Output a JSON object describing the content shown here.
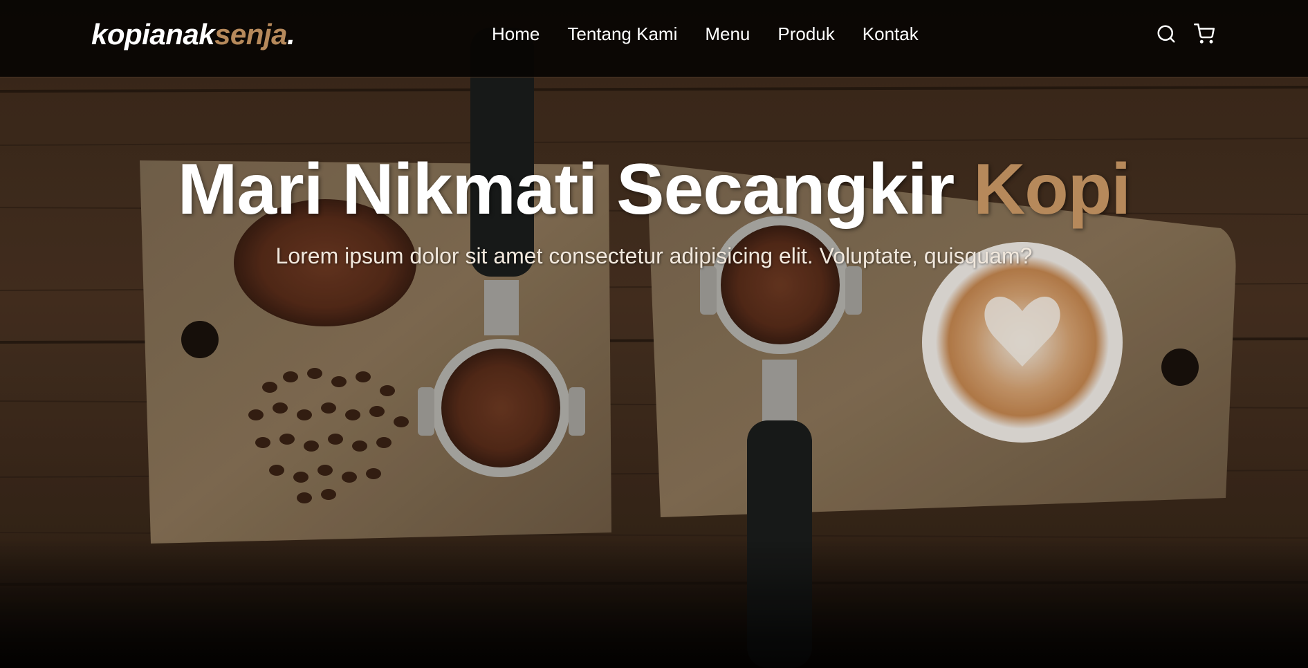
{
  "brand": {
    "name_main": "kopianak",
    "name_accent": "senja",
    "name_suffix": "."
  },
  "nav": {
    "links": [
      "Home",
      "Tentang Kami",
      "Menu",
      "Produk",
      "Kontak"
    ],
    "icons": [
      "search-icon",
      "shopping-cart-icon"
    ]
  },
  "hero": {
    "title_main": "Mari Nikmati Secangkir ",
    "title_accent": "Kopi",
    "subtitle": "Lorem ipsum dolor sit amet consectetur adipisicing elit. Voluptate, quisquam?"
  },
  "colors": {
    "accent": "#b6895b",
    "nav_bg": "#0c0806",
    "text": "#ffffff"
  }
}
